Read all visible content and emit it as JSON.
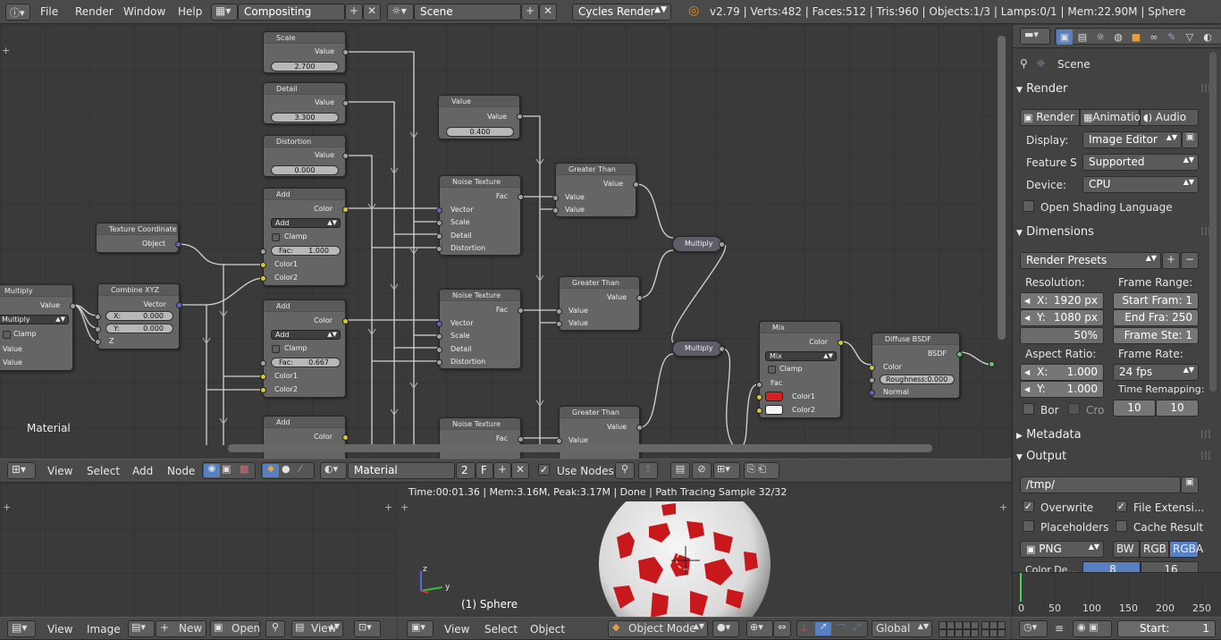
{
  "topbar": {
    "menus": [
      "File",
      "Render",
      "Window",
      "Help"
    ],
    "screen_layout": "Compositing",
    "scene": "Scene",
    "render_engine": "Cycles Render",
    "stats": "v2.79 | Verts:482 | Faces:512 | Tris:960 | Objects:1/3 | Lamps:0/1 | Mem:22.90M | Sphere"
  },
  "node_editor": {
    "material_label": "Material",
    "nodes": {
      "scale": {
        "title": "Scale",
        "out": "Value",
        "value": "2.700"
      },
      "detail": {
        "title": "Detail",
        "out": "Value",
        "value": "3.300"
      },
      "distortion": {
        "title": "Distortion",
        "out": "Value",
        "value": "0.000"
      },
      "value": {
        "title": "Value",
        "out": "Value",
        "value": "0.400"
      },
      "add1": {
        "title": "Add",
        "out": "Color",
        "mode": "Add",
        "clamp": "Clamp",
        "fac": "Fac:",
        "fac_value": "1.000",
        "c1": "Color1",
        "c2": "Color2"
      },
      "add2": {
        "title": "Add",
        "out": "Color",
        "mode": "Add",
        "clamp": "Clamp",
        "fac": "Fac:",
        "fac_value": "0.667",
        "c1": "Color1",
        "c2": "Color2"
      },
      "add3": {
        "title": "Add",
        "out": "Color"
      },
      "texcoord": {
        "title": "Texture Coordinate",
        "out": "Object"
      },
      "combine": {
        "title": "Combine XYZ",
        "out": "Vector",
        "x": "X:",
        "x_value": "0.000",
        "y": "Y:",
        "y_value": "0.000",
        "z": "Z"
      },
      "multiply_left": {
        "title": "Multiply",
        "out": "Value",
        "mode": "Multiply",
        "clamp": "Clamp",
        "in1": "Value",
        "in2": "Value"
      },
      "noise1": {
        "title": "Noise Texture",
        "out": "Fac",
        "vector": "Vector",
        "scale": "Scale",
        "detail": "Detail",
        "distortion": "Distortion"
      },
      "noise2": {
        "title": "Noise Texture",
        "out": "Fac",
        "vector": "Vector",
        "scale": "Scale",
        "detail": "Detail",
        "distortion": "Distortion"
      },
      "noise3": {
        "title": "Noise Texture",
        "out": "Fac"
      },
      "gt1": {
        "title": "Greater Than",
        "out": "Value",
        "in1": "Value",
        "in2": "Value"
      },
      "gt2": {
        "title": "Greater Than",
        "out": "Value",
        "in1": "Value",
        "in2": "Value"
      },
      "gt3": {
        "title": "Greater Than",
        "out": "Value",
        "in1": "Value"
      },
      "mult1": {
        "title": "Multiply"
      },
      "mult2": {
        "title": "Multiply"
      },
      "mix": {
        "title": "Mix",
        "out": "Color",
        "mode": "Mix",
        "clamp": "Clamp",
        "fac": "Fac",
        "c1": "Color1",
        "c2": "Color2",
        "color1": "#d82020",
        "color2": "#f4f4f4"
      },
      "diffuse": {
        "title": "Diffuse BSDF",
        "out": "BSDF",
        "color": "Color",
        "roughness": "Roughness:",
        "roughness_value": "0.000",
        "normal": "Normal"
      }
    }
  },
  "node_header": {
    "menus": [
      "View",
      "Select",
      "Add",
      "Node"
    ],
    "material": "Material",
    "users": "2",
    "fake": "F",
    "use_nodes": "Use Nodes"
  },
  "image_editor_header": {
    "menus": [
      "View",
      "Image"
    ],
    "new": "New",
    "open": "Open",
    "view": "View"
  },
  "viewport": {
    "render_info": "Time:00:01.36 | Mem:3.16M, Peak:3.17M | Done | Path Tracing Sample 32/32",
    "object_label": "(1) Sphere",
    "menus": [
      "View",
      "Select",
      "Object"
    ],
    "mode": "Object Mode",
    "orientation": "Global"
  },
  "properties": {
    "context": "Scene",
    "render_section": "Render",
    "render_btn": "Render",
    "animation_btn": "Animatio",
    "audio_btn": "Audio",
    "display_label": "Display:",
    "display_value": "Image Editor",
    "feature_label": "Feature S",
    "feature_value": "Supported",
    "device_label": "Device:",
    "device_value": "CPU",
    "osl": "Open Shading Language",
    "dimensions_section": "Dimensions",
    "presets": "Render Presets",
    "resolution": "Resolution:",
    "res_x": "X:",
    "res_x_value": "1920 px",
    "res_y": "Y:",
    "res_y_value": "1080 px",
    "res_pct": "50%",
    "frame_range": "Frame Range:",
    "start_frame": "Start Fram: 1",
    "end_frame": "End Fra: 250",
    "frame_step": "Frame Ste: 1",
    "aspect": "Aspect Ratio:",
    "asp_x": "X:",
    "asp_x_value": "1.000",
    "asp_y": "Y:",
    "asp_y_value": "1.000",
    "frame_rate": "Frame Rate:",
    "fps": "24 fps",
    "time_remap": "Time Remapping:",
    "remap_old": "10",
    "remap_new": "10",
    "border": "Bor",
    "crop": "Cro",
    "metadata_section": "Metadata",
    "output_section": "Output",
    "output_path": "/tmp/",
    "overwrite": "Overwrite",
    "file_ext": "File Extensi...",
    "placeholders": "Placeholders",
    "cache_result": "Cache Result",
    "format": "PNG",
    "bw": "BW",
    "rgb": "RGB",
    "rgba": "RGBA",
    "color_depth": "Color De...",
    "depth_8": "8",
    "depth_16": "16"
  },
  "timeline": {
    "ticks": [
      "0",
      "50",
      "100",
      "150",
      "200",
      "250"
    ],
    "start_label": "Start:",
    "start_value": "1"
  }
}
